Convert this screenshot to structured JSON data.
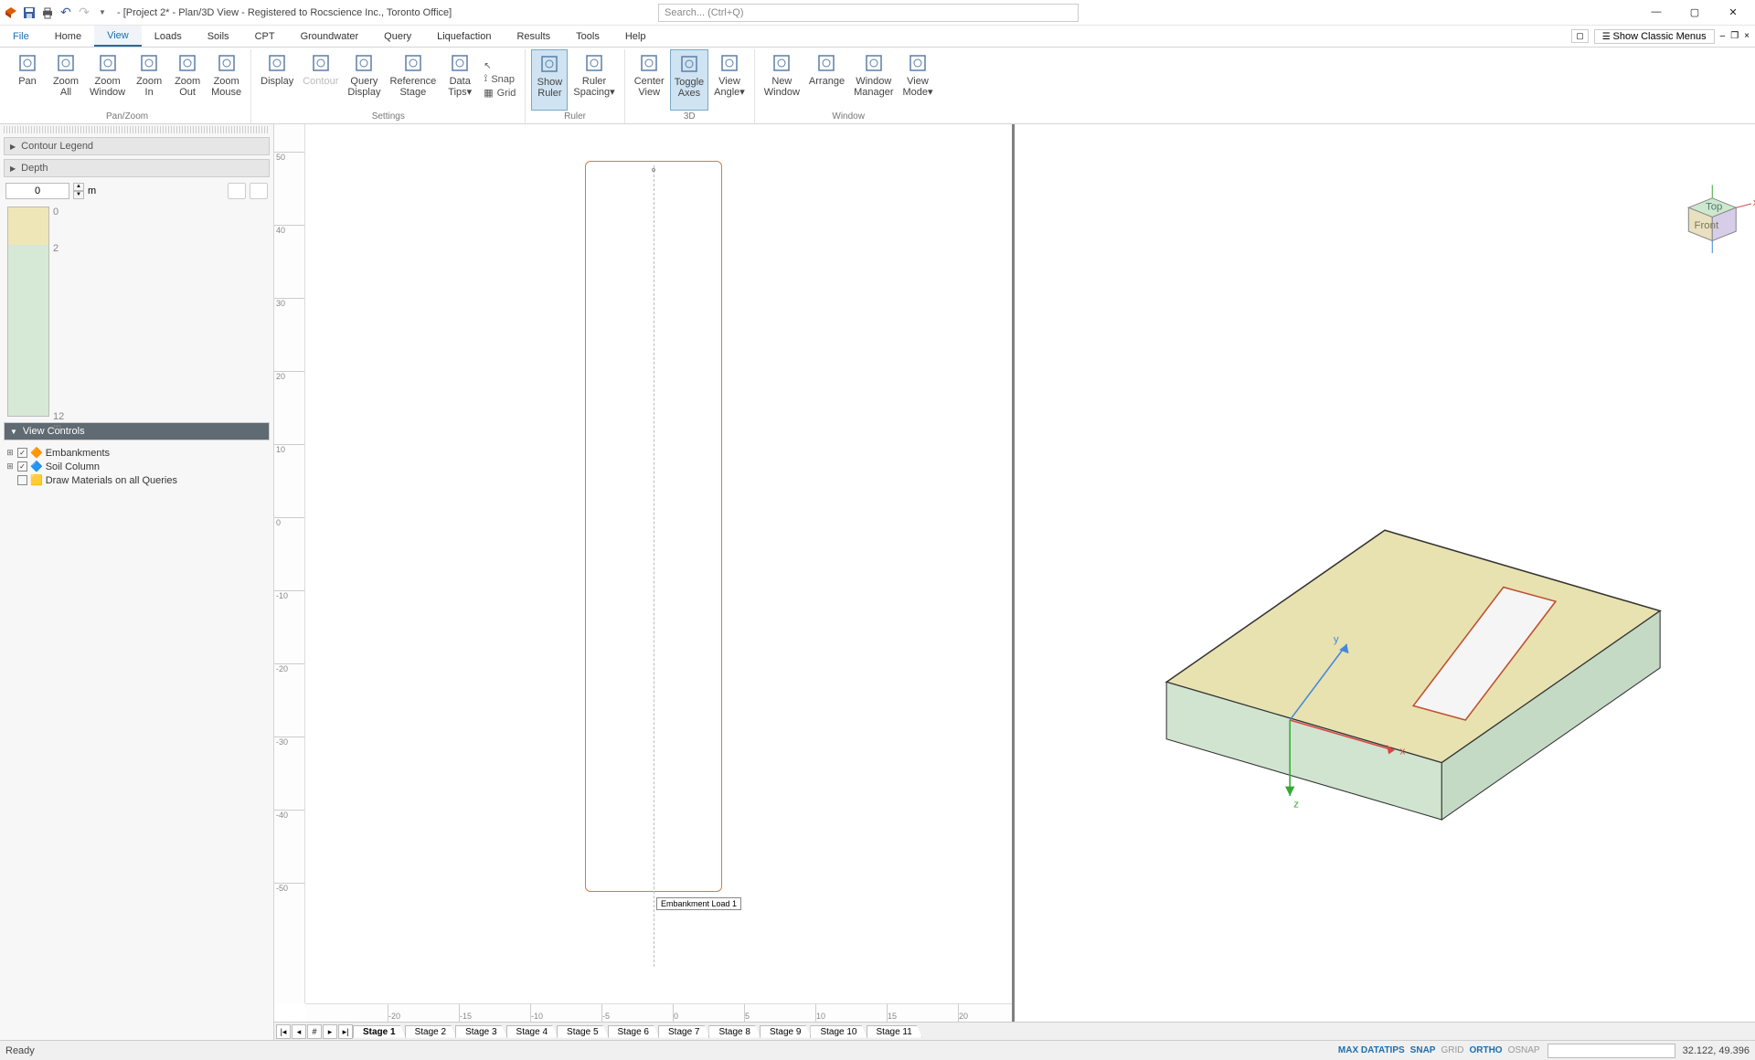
{
  "title": "- [Project 2* - Plan/3D View - Registered to Rocscience Inc., Toronto Office]",
  "search_placeholder": "Search... (Ctrl+Q)",
  "classic_menus": "Show Classic Menus",
  "menu": [
    "File",
    "Home",
    "View",
    "Loads",
    "Soils",
    "CPT",
    "Groundwater",
    "Query",
    "Liquefaction",
    "Results",
    "Tools",
    "Help"
  ],
  "active_menu": "View",
  "ribbon": {
    "panzoom": {
      "label": "Pan/Zoom",
      "items": [
        "Pan",
        "Zoom All",
        "Zoom Window",
        "Zoom In",
        "Zoom Out",
        "Zoom Mouse"
      ]
    },
    "settings": {
      "label": "Settings",
      "items": [
        "Display",
        "Contour",
        "Query Display",
        "Reference Stage",
        "Data Tips▾"
      ],
      "snap": "Snap",
      "grid": "Grid"
    },
    "ruler": {
      "label": "Ruler",
      "items": [
        "Show Ruler",
        "Ruler Spacing▾"
      ]
    },
    "threeD": {
      "label": "3D",
      "items": [
        "Center View",
        "Toggle Axes",
        "View Angle▾"
      ]
    },
    "window": {
      "label": "Window",
      "items": [
        "New Window",
        "Arrange",
        "Window Manager",
        "View Mode▾"
      ]
    }
  },
  "sidebar": {
    "contour_legend": "Contour Legend",
    "depth": "Depth",
    "depth_value": "0",
    "depth_unit": "m",
    "gauge_top": "0",
    "gauge_mid": "2",
    "gauge_bottom": "12 m",
    "view_controls": "View Controls",
    "tree": {
      "embankments": "Embankments",
      "soil_column": "Soil Column",
      "draw_materials": "Draw Materials on all Queries"
    }
  },
  "plan": {
    "label": "Embankment Load 1",
    "yticks": [
      "50",
      "40",
      "30",
      "20",
      "10",
      "0",
      "-10",
      "-20",
      "-30",
      "-40",
      "-50"
    ],
    "xticks": [
      "-20",
      "-15",
      "-10",
      "-5",
      "0",
      "5",
      "10",
      "15",
      "20"
    ]
  },
  "axes3d": {
    "x": "x",
    "y": "y",
    "z": "z"
  },
  "cube": {
    "top": "Top",
    "front": "Front"
  },
  "stages": [
    "Stage 1",
    "Stage 2",
    "Stage 3",
    "Stage 4",
    "Stage 5",
    "Stage 6",
    "Stage 7",
    "Stage 8",
    "Stage 9",
    "Stage 10",
    "Stage 11"
  ],
  "active_stage": "Stage 1",
  "status": {
    "ready": "Ready",
    "toggles": [
      "MAX DATATIPS",
      "SNAP",
      "GRID",
      "ORTHO",
      "OSNAP"
    ],
    "toggles_on": [
      "MAX DATATIPS",
      "SNAP",
      "ORTHO"
    ],
    "coords": "32.122, 49.396"
  }
}
